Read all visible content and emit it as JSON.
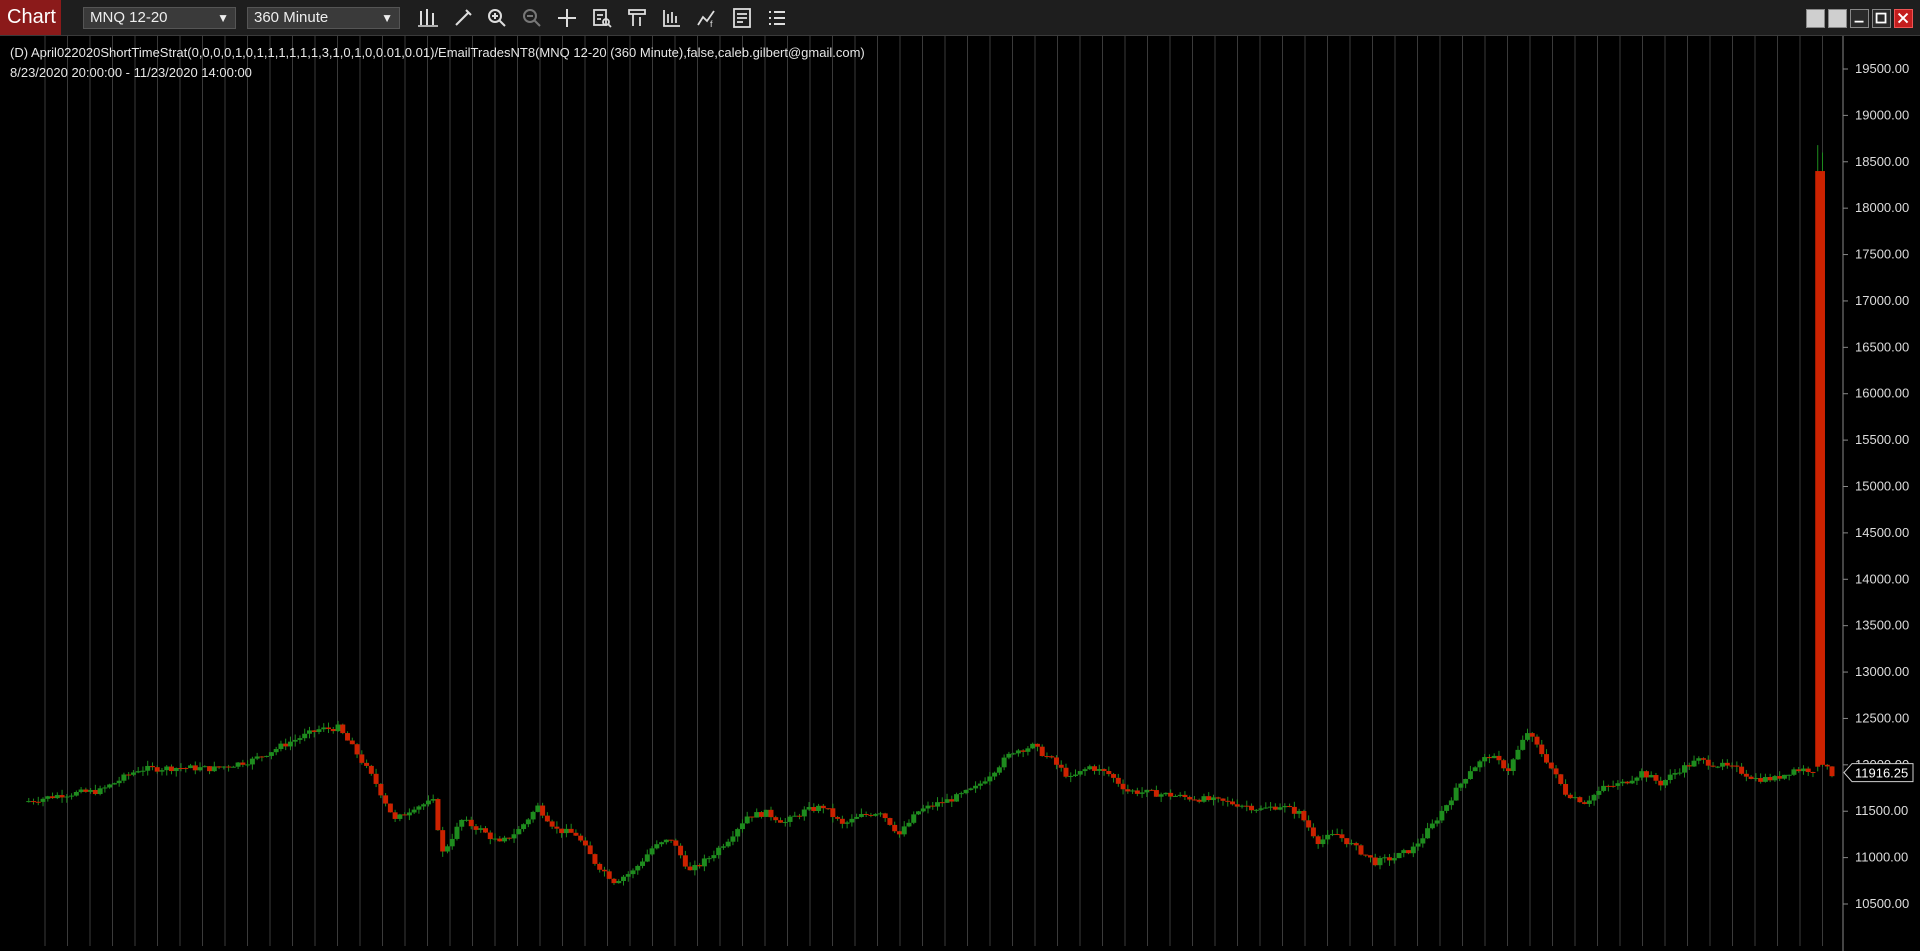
{
  "window": {
    "tab_label": "Chart",
    "instrument": "MNQ 12-20",
    "interval": "360 Minute"
  },
  "toolbar": {
    "tools": [
      "bar-type-icon",
      "draw-pencil-icon",
      "zoom-in-icon",
      "zoom-out-icon",
      "crosshair-icon",
      "data-box-icon",
      "chart-trader-icon",
      "properties-icon",
      "strategies-icon",
      "indicators-icon"
    ]
  },
  "chart": {
    "strategy_label": "(D) April022020ShortTimeStrat(0,0,0,0,1,0,1,1,1,1,1,1,3,1,0,1,0,0.01,0.01)/EmailTradesNT8(MNQ 12-20 (360 Minute),false,caleb.gilbert@gmail.com)",
    "date_range": "8/23/2020 20:00:00 - 11/23/2020 14:00:00",
    "last_price_label": "11916.25"
  },
  "colors": {
    "up": "#1e8c1e",
    "down": "#cc2200",
    "background": "#000000",
    "grid": "#3a3a3a",
    "tab": "#8b1a1a"
  },
  "chart_data": {
    "type": "candlestick",
    "instrument": "MNQ 12-20",
    "ylim": [
      10200,
      19800
    ],
    "y_ticks": [
      "10500.00",
      "11000.00",
      "11500.00",
      "12000.00",
      "12500.00",
      "13000.00",
      "13500.00",
      "14000.00",
      "14500.00",
      "15000.00",
      "15500.00",
      "16000.00",
      "16500.00",
      "17000.00",
      "17500.00",
      "18000.00",
      "18500.00",
      "19000.00",
      "19500.00"
    ],
    "y_tick_values": [
      10500,
      11000,
      11500,
      12000,
      12500,
      13000,
      13500,
      14000,
      14500,
      15000,
      15500,
      16000,
      16500,
      17000,
      17500,
      18000,
      18500,
      19000,
      19500
    ],
    "last_price": 11916.25,
    "close_path": [
      [
        0,
        11600
      ],
      [
        8,
        11680
      ],
      [
        16,
        11720
      ],
      [
        24,
        11950
      ],
      [
        32,
        11970
      ],
      [
        40,
        11960
      ],
      [
        48,
        12050
      ],
      [
        56,
        12250
      ],
      [
        62,
        12380
      ],
      [
        66,
        12400
      ],
      [
        70,
        12120
      ],
      [
        74,
        11800
      ],
      [
        78,
        11400
      ],
      [
        82,
        11550
      ],
      [
        86,
        11600
      ],
      [
        88,
        11050
      ],
      [
        92,
        11400
      ],
      [
        96,
        11300
      ],
      [
        100,
        11150
      ],
      [
        104,
        11300
      ],
      [
        108,
        11550
      ],
      [
        112,
        11300
      ],
      [
        116,
        11250
      ],
      [
        120,
        10950
      ],
      [
        124,
        10750
      ],
      [
        128,
        10850
      ],
      [
        132,
        11100
      ],
      [
        136,
        11200
      ],
      [
        140,
        10850
      ],
      [
        144,
        11000
      ],
      [
        148,
        11200
      ],
      [
        152,
        11450
      ],
      [
        156,
        11480
      ],
      [
        160,
        11380
      ],
      [
        164,
        11500
      ],
      [
        168,
        11550
      ],
      [
        172,
        11350
      ],
      [
        176,
        11450
      ],
      [
        180,
        11500
      ],
      [
        184,
        11250
      ],
      [
        188,
        11500
      ],
      [
        192,
        11580
      ],
      [
        196,
        11650
      ],
      [
        200,
        11750
      ],
      [
        204,
        11950
      ],
      [
        208,
        12150
      ],
      [
        212,
        12200
      ],
      [
        216,
        12050
      ],
      [
        220,
        11850
      ],
      [
        224,
        11980
      ],
      [
        228,
        11900
      ],
      [
        232,
        11720
      ],
      [
        236,
        11700
      ],
      [
        240,
        11680
      ],
      [
        244,
        11650
      ],
      [
        248,
        11630
      ],
      [
        252,
        11600
      ],
      [
        256,
        11570
      ],
      [
        260,
        11520
      ],
      [
        264,
        11560
      ],
      [
        268,
        11480
      ],
      [
        272,
        11180
      ],
      [
        276,
        11250
      ],
      [
        280,
        11100
      ],
      [
        284,
        10950
      ],
      [
        288,
        11000
      ],
      [
        292,
        11100
      ],
      [
        296,
        11350
      ],
      [
        300,
        11650
      ],
      [
        304,
        11950
      ],
      [
        308,
        12100
      ],
      [
        312,
        11950
      ],
      [
        316,
        12350
      ],
      [
        320,
        12050
      ],
      [
        324,
        11700
      ],
      [
        328,
        11600
      ],
      [
        332,
        11750
      ],
      [
        336,
        11800
      ],
      [
        340,
        11920
      ],
      [
        344,
        11800
      ],
      [
        348,
        11950
      ],
      [
        352,
        12050
      ],
      [
        356,
        12000
      ],
      [
        360,
        11950
      ],
      [
        364,
        11850
      ],
      [
        368,
        11850
      ],
      [
        372,
        11950
      ],
      [
        376,
        11950
      ],
      [
        377,
        18650
      ],
      [
        378,
        12000
      ],
      [
        380,
        11900
      ]
    ],
    "spike": {
      "open": 11980,
      "high": 18680,
      "low": 11930,
      "close": 18400
    }
  }
}
